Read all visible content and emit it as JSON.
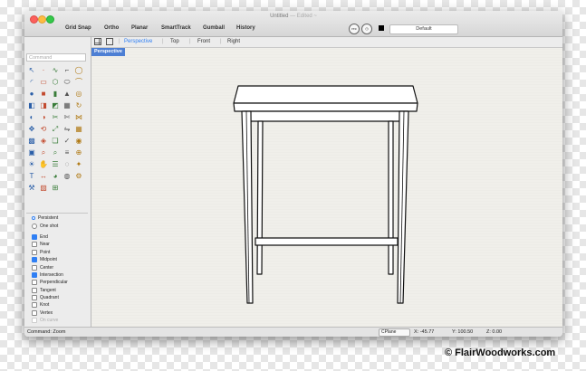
{
  "window": {
    "title": "Untitled",
    "edited": "— Edited ~"
  },
  "toolbar": {
    "buttons": [
      "Grid Snap",
      "Ortho",
      "Planar",
      "SmartTrack",
      "Gumball",
      "History"
    ],
    "layer": "Default"
  },
  "command": {
    "placeholder": "Command"
  },
  "tools": [
    "arrow",
    "point",
    "curve",
    "polyline",
    "circle",
    "arc",
    "rectangle",
    "polygon",
    "ellipse",
    "curve-fillet",
    "sphere",
    "box",
    "cylinder",
    "cone",
    "torus",
    "surface",
    "loft",
    "sweep",
    "extrude",
    "revolve",
    "boolean-union",
    "boolean-difference",
    "split",
    "trim",
    "join",
    "move",
    "rotate",
    "scale",
    "mirror",
    "array",
    "grid",
    "select",
    "group",
    "check",
    "render",
    "camera",
    "zoom",
    "search",
    "match",
    "analyze",
    "lights",
    "pan",
    "layers",
    "view",
    "bulb",
    "text",
    "dim",
    "color",
    "globe",
    "options",
    "wrench",
    "hatch",
    "properties"
  ],
  "snaps": {
    "mode": [
      {
        "label": "Persistent",
        "selected": true
      },
      {
        "label": "One shot",
        "selected": false
      }
    ],
    "items": [
      {
        "label": "End",
        "checked": true
      },
      {
        "label": "Near",
        "checked": false
      },
      {
        "label": "Point",
        "checked": false
      },
      {
        "label": "Midpoint",
        "checked": true
      },
      {
        "label": "Center",
        "checked": false
      },
      {
        "label": "Intersection",
        "checked": true
      },
      {
        "label": "Perpendicular",
        "checked": false
      },
      {
        "label": "Tangent",
        "checked": false
      },
      {
        "label": "Quadrant",
        "checked": false
      },
      {
        "label": "Knot",
        "checked": false
      },
      {
        "label": "Vertex",
        "checked": false
      },
      {
        "label": "On curve",
        "checked": false,
        "disabled": true
      }
    ]
  },
  "viewtabs": [
    "Perspective",
    "Top",
    "Front",
    "Right"
  ],
  "viewport": {
    "label": "Perspective"
  },
  "status": {
    "command": "Command: Zoom",
    "cplane": "CPlane",
    "x": "X: -45.77",
    "y": "Y: 100.50",
    "z": "Z: 0.00"
  },
  "watermark": "© FlairWoodworks.com",
  "colors": {
    "accent": "#2f7ff4",
    "viewport_label_bg": "#4d7fd4"
  }
}
